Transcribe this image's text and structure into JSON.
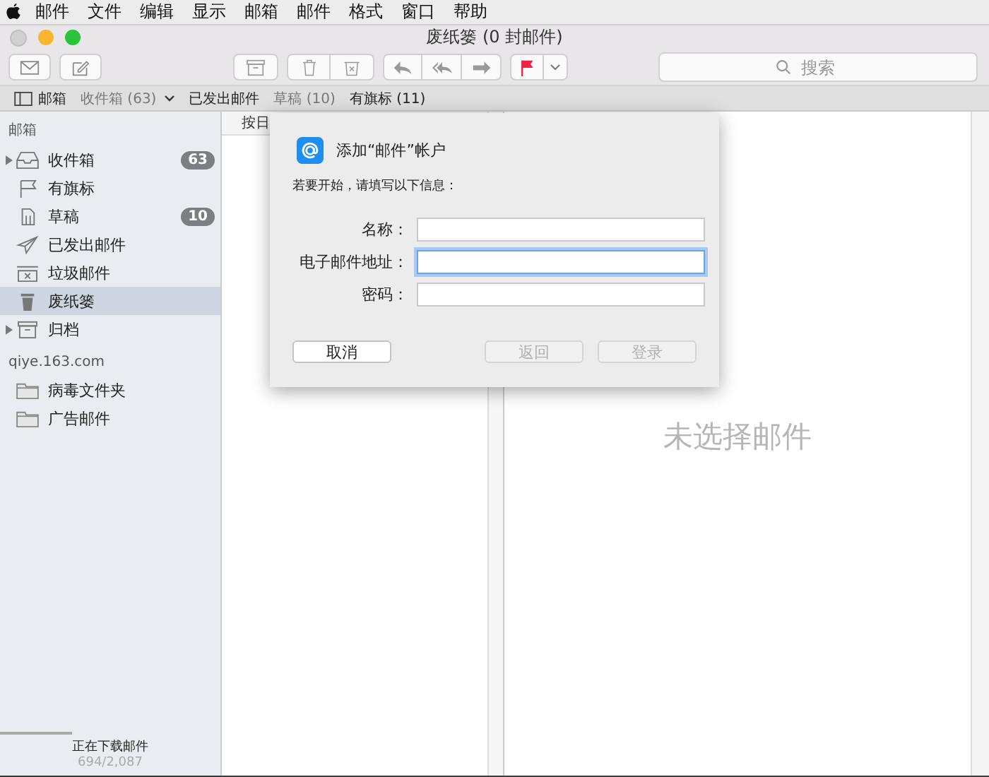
{
  "menu_bar": {
    "items": [
      "邮件",
      "文件",
      "编辑",
      "显示",
      "邮箱",
      "邮件",
      "格式",
      "窗口",
      "帮助"
    ]
  },
  "window": {
    "title": "废纸篓 (0 封邮件)"
  },
  "toolbar": {
    "search": {
      "placeholder": "搜索"
    }
  },
  "favorites_bar": [
    {
      "label": "邮箱",
      "kind": "toggle",
      "dimmed": false
    },
    {
      "label": "收件箱 (63)",
      "kind": "menu",
      "dimmed": true
    },
    {
      "label": "已发出邮件",
      "kind": "plain",
      "dimmed": false
    },
    {
      "label": "草稿 (10)",
      "kind": "plain",
      "dimmed": true
    },
    {
      "label": "有旗标 (11)",
      "kind": "plain",
      "dimmed": false
    }
  ],
  "sidebar": {
    "sections": [
      {
        "heading": "邮箱",
        "items": [
          {
            "label": "收件箱",
            "kind": "inbox",
            "count": "63",
            "expandable": true,
            "selected": false
          },
          {
            "label": "有旗标",
            "kind": "flag",
            "expandable": false,
            "selected": false
          },
          {
            "label": "草稿",
            "kind": "draft",
            "count": "10",
            "expandable": false,
            "selected": false
          },
          {
            "label": "已发出邮件",
            "kind": "sent",
            "expandable": false,
            "selected": false
          },
          {
            "label": "垃圾邮件",
            "kind": "junk",
            "expandable": false,
            "selected": false
          },
          {
            "label": "废纸篓",
            "kind": "trash",
            "expandable": false,
            "selected": true
          },
          {
            "label": "归档",
            "kind": "archive",
            "expandable": true,
            "selected": false
          }
        ]
      },
      {
        "heading": "qiye.163.com",
        "items": [
          {
            "label": "病毒文件夹",
            "kind": "folder",
            "expandable": false,
            "selected": false
          },
          {
            "label": "广告邮件",
            "kind": "folder",
            "expandable": false,
            "selected": false
          }
        ]
      }
    ],
    "status": {
      "text": "正在下载邮件",
      "count": "694/2,087",
      "level": 0.33
    }
  },
  "message_list": {
    "sort_label": "按日"
  },
  "viewer": {
    "empty_text": "未选择邮件"
  },
  "dialog": {
    "title": "添加“邮件”帐户",
    "intro": "若要开始，请填写以下信息：",
    "fields": [
      {
        "label": "名称：",
        "focused": false
      },
      {
        "label": "电子邮件地址：",
        "focused": true
      },
      {
        "label": "密码：",
        "focused": false
      }
    ],
    "buttons": [
      {
        "label": "取消",
        "disabled": false
      },
      {
        "label": "返回",
        "disabled": true
      },
      {
        "label": "登录",
        "disabled": true
      }
    ]
  }
}
